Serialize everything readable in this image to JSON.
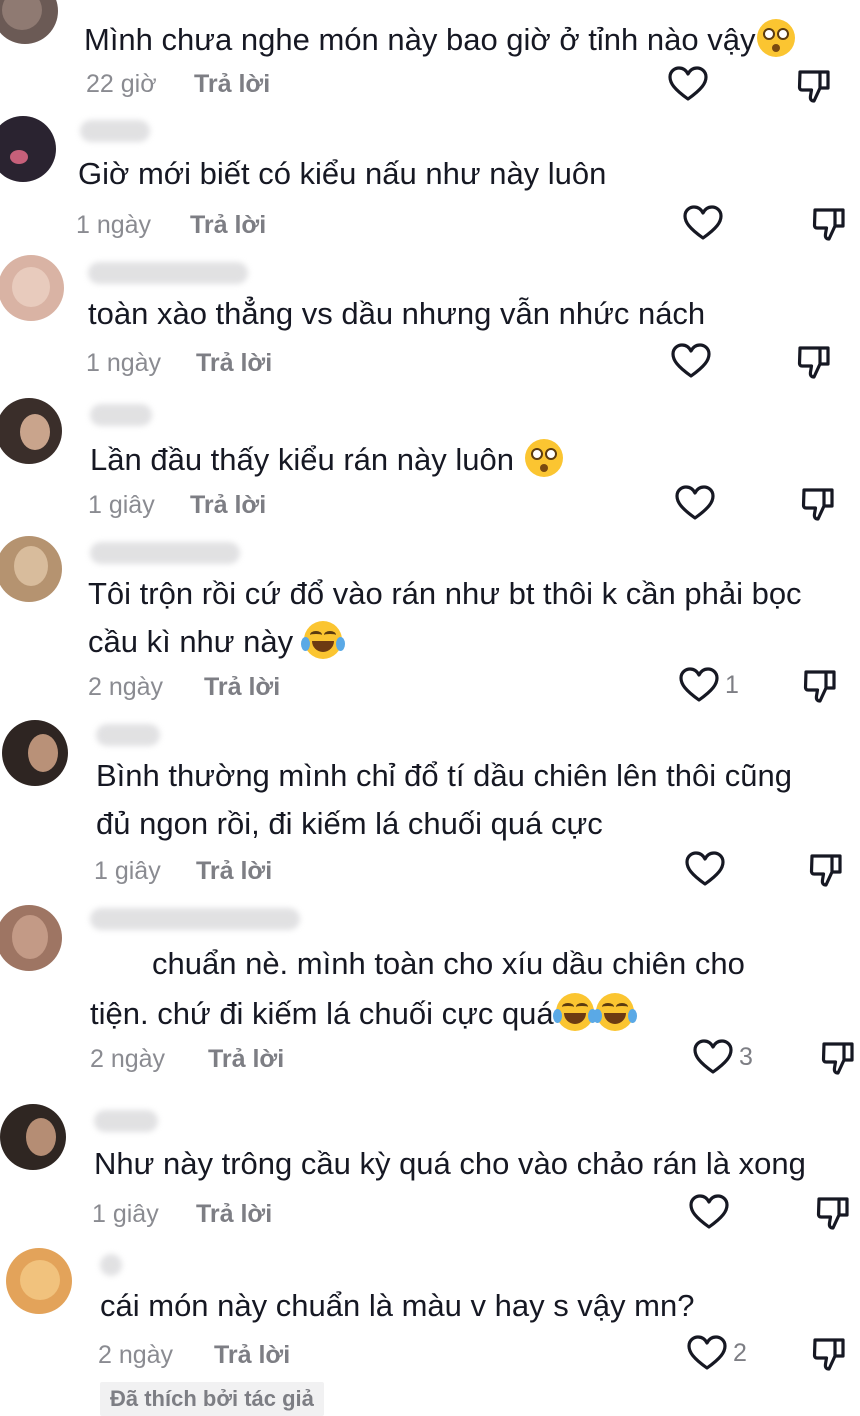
{
  "comments": [
    {
      "text": "Mình chưa nghe món này bao giờ ở tỉnh nào vậy",
      "emoji": [
        "flushed-emoji"
      ],
      "time": "22 giờ",
      "reply": "Trả lời",
      "likes": ""
    },
    {
      "text": "Giờ mới biết có kiểu nấu như này luôn",
      "emoji": [],
      "time": "1 ngày",
      "reply": "Trả lời",
      "likes": ""
    },
    {
      "text": "toàn xào thẳng vs dầu nhưng vẫn nhức nách",
      "emoji": [],
      "time": "1 ngày",
      "reply": "Trả lời",
      "likes": ""
    },
    {
      "text": "Lần đầu thấy kiểu rán này luôn ",
      "emoji": [
        "flushed-emoji"
      ],
      "time": "1 giây",
      "reply": "Trả lời",
      "likes": ""
    },
    {
      "text": "Tôi trộn rồi cứ đổ vào rán như bt thôi k cần phải bọc",
      "text2": "cầu kì như này ",
      "emoji": [
        "laughing-tears-emoji"
      ],
      "time": "2 ngày",
      "reply": "Trả lời",
      "likes": "1"
    },
    {
      "text": "Bình thường mình chỉ đổ tí dầu chiên lên thôi cũng",
      "text2": "đủ ngon rồi, đi kiếm lá chuối quá cực",
      "emoji": [],
      "time": "1 giây",
      "reply": "Trả lời",
      "likes": ""
    },
    {
      "text": "chuẩn nè. mình toàn cho xíu dầu chiên cho",
      "text2": "tiện. chứ đi kiếm lá chuối cực quá",
      "emoji": [
        "laughing-tears-emoji",
        "laughing-tears-emoji"
      ],
      "time": "2 ngày",
      "reply": "Trả lời",
      "likes": "3"
    },
    {
      "text": "Như này trông cầu kỳ quá cho vào chảo rán là xong",
      "emoji": [],
      "time": "1 giây",
      "reply": "Trả lời",
      "likes": ""
    },
    {
      "text": "cái món này chuẩn là màu v hay s vậy mn?",
      "emoji": [],
      "time": "2 ngày",
      "reply": "Trả lời",
      "likes": "2"
    }
  ],
  "author_liked_badge": "Đã thích bởi tác giả",
  "colors": {
    "text": "#161823",
    "meta": "#8a8b91",
    "icon": "#161823",
    "badge_bg": "#f1f1f2"
  }
}
